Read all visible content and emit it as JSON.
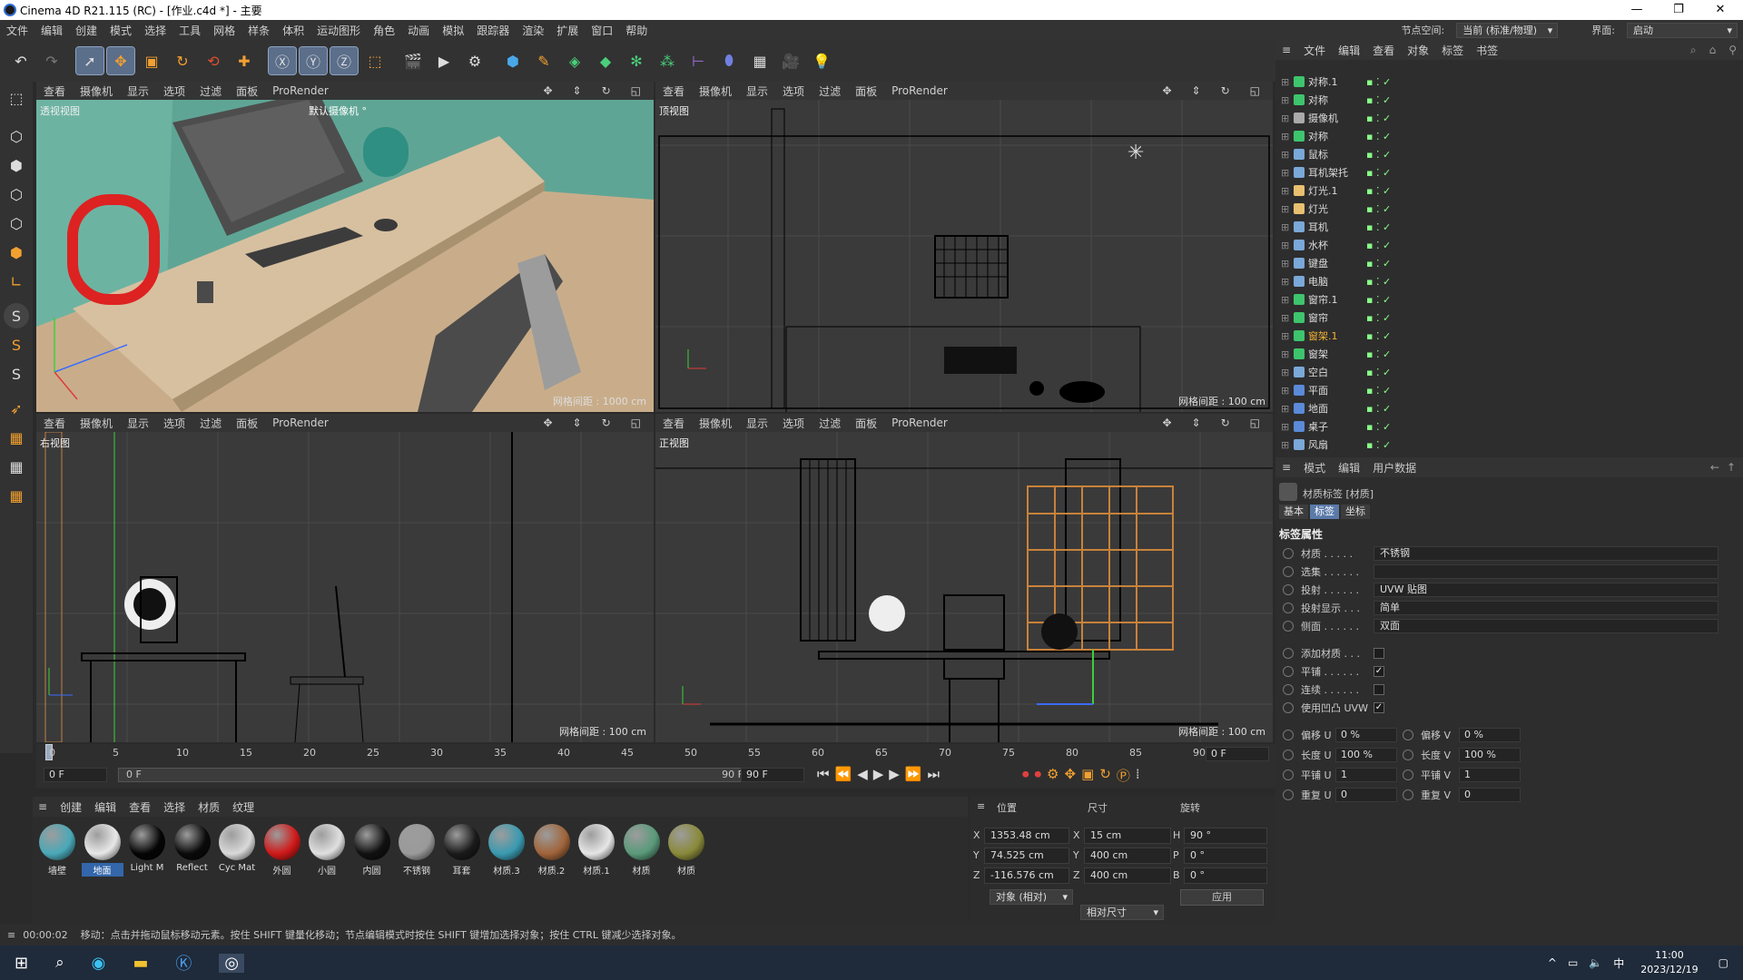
{
  "window": {
    "title": "Cinema 4D R21.115 (RC) - [作业.c4d *] - 主要"
  },
  "menu": [
    "文件",
    "编辑",
    "创建",
    "模式",
    "选择",
    "工具",
    "网格",
    "样条",
    "体积",
    "运动图形",
    "角色",
    "动画",
    "模拟",
    "跟踪器",
    "渲染",
    "扩展",
    "窗口",
    "帮助"
  ],
  "node_space": {
    "label": "节点空间:",
    "value": "当前 (标准/物理)"
  },
  "interface": {
    "label": "界面:",
    "value": "启动"
  },
  "viewport_menu": [
    "查看",
    "摄像机",
    "显示",
    "选项",
    "过滤",
    "面板",
    "ProRender"
  ],
  "viewports": {
    "persp": {
      "label": "透视视图",
      "camera": "默认摄像机 °",
      "grid": "网格间距 : 1000 cm"
    },
    "top": {
      "label": "顶视图",
      "grid": "网格间距 : 100 cm"
    },
    "right": {
      "label": "右视图",
      "grid": "网格间距 : 100 cm"
    },
    "front": {
      "label": "正视图",
      "grid": "网格间距 : 100 cm"
    }
  },
  "timeline": {
    "ticks": [
      "0",
      "5",
      "10",
      "15",
      "20",
      "25",
      "30",
      "35",
      "40",
      "45",
      "50",
      "55",
      "60",
      "65",
      "70",
      "75",
      "80",
      "85",
      "90"
    ],
    "end_field": "0 F"
  },
  "transport": {
    "start": "0 F",
    "current": "0 F",
    "end1": "90 F",
    "end2": "90 F"
  },
  "material_menu": [
    "创建",
    "编辑",
    "查看",
    "选择",
    "材质",
    "纹理"
  ],
  "materials": [
    {
      "name": "墙壁",
      "color": "#4aa8b8"
    },
    {
      "name": "地面",
      "color": "#e8e8e8",
      "selected": true
    },
    {
      "name": "Light M",
      "color": "#050505"
    },
    {
      "name": "Reflect",
      "color": "#0a0a0a"
    },
    {
      "name": "Cyc Mat",
      "color": "#d9d9d9"
    },
    {
      "name": "外圆",
      "color": "#d01818"
    },
    {
      "name": "小圆",
      "color": "#e0e0e0"
    },
    {
      "name": "内圆",
      "color": "#111111"
    },
    {
      "name": "不锈钢",
      "color": "#9a9a9a"
    },
    {
      "name": "耳套",
      "color": "#1a1a1a"
    },
    {
      "name": "材质.3",
      "color": "#3a9ab0"
    },
    {
      "name": "材质.2",
      "color": "#a0643a"
    },
    {
      "name": "材质.1",
      "color": "#e6e6e6"
    },
    {
      "name": "材质",
      "color": "#5a9a7a"
    },
    {
      "name": "材质",
      "color": "#8a8a3a"
    }
  ],
  "coords": {
    "headers": [
      "位置",
      "尺寸",
      "旋转"
    ],
    "rows": [
      {
        "axis": "X",
        "pos": "1353.48 cm",
        "saxis": "X",
        "size": "15 cm",
        "raxis": "H",
        "rot": "90 °"
      },
      {
        "axis": "Y",
        "pos": "74.525 cm",
        "saxis": "Y",
        "size": "400 cm",
        "raxis": "P",
        "rot": "0 °"
      },
      {
        "axis": "Z",
        "pos": "-116.576 cm",
        "saxis": "Z",
        "size": "400 cm",
        "raxis": "B",
        "rot": "0 °"
      }
    ],
    "mode1": "对象 (相对)",
    "mode2": "相对尺寸",
    "apply": "应用"
  },
  "object_menu": [
    "文件",
    "编辑",
    "查看",
    "对象",
    "标签",
    "书签"
  ],
  "objects": [
    {
      "name": "对称.1",
      "color": "#3ec46d"
    },
    {
      "name": "对称",
      "color": "#3ec46d"
    },
    {
      "name": "摄像机",
      "color": "#aaaaaa"
    },
    {
      "name": "对称",
      "color": "#3ec46d"
    },
    {
      "name": "鼠标",
      "color": "#7aa8d8"
    },
    {
      "name": "耳机架托",
      "color": "#7aa8d8"
    },
    {
      "name": "灯光.1",
      "color": "#e8c070"
    },
    {
      "name": "灯光",
      "color": "#e8c070"
    },
    {
      "name": "耳机",
      "color": "#7aa8d8"
    },
    {
      "name": "水杯",
      "color": "#7aa8d8"
    },
    {
      "name": "键盘",
      "color": "#7aa8d8"
    },
    {
      "name": "电脑",
      "color": "#7aa8d8"
    },
    {
      "name": "窗帘.1",
      "color": "#3ec46d"
    },
    {
      "name": "窗帘",
      "color": "#3ec46d"
    },
    {
      "name": "窗架.1",
      "color": "#3ec46d",
      "highlight": true
    },
    {
      "name": "窗架",
      "color": "#3ec46d"
    },
    {
      "name": "空白",
      "color": "#7aa8d8"
    },
    {
      "name": "平面",
      "color": "#5a8ad8"
    },
    {
      "name": "地面",
      "color": "#5a8ad8"
    },
    {
      "name": "桌子",
      "color": "#5a8ad8"
    },
    {
      "name": "风扇",
      "color": "#7aa8d8"
    }
  ],
  "attr_menu": [
    "模式",
    "编辑",
    "用户数据"
  ],
  "attr": {
    "title": "材质标签 [材质]",
    "tabs": [
      "基本",
      "标签",
      "坐标"
    ],
    "section": "标签属性",
    "material": {
      "k": "材质 . . . . .",
      "v": "不锈钢"
    },
    "selection": {
      "k": "选集 . . . . . .",
      "v": ""
    },
    "projection": {
      "k": "投射 . . . . . .",
      "v": "UVW 贴图"
    },
    "proj_display": {
      "k": "投射显示 . . .",
      "v": "简单"
    },
    "side": {
      "k": "侧面 . . . . . .",
      "v": "双面"
    },
    "add_mat": "添加材质 . . .",
    "tile": "平铺 . . . . . .",
    "continuous": "连续 . . . . . .",
    "use_bump_uvw": "使用凹凸 UVW",
    "offset_u": {
      "k": "偏移 U",
      "v": "0 %"
    },
    "offset_v": {
      "k": "偏移 V",
      "v": "0 %"
    },
    "len_u": {
      "k": "长度 U",
      "v": "100 %"
    },
    "len_v": {
      "k": "长度 V",
      "v": "100 %"
    },
    "tile_u": {
      "k": "平铺 U",
      "v": "1"
    },
    "tile_v": {
      "k": "平铺 V",
      "v": "1"
    },
    "rep_u": {
      "k": "重复 U",
      "v": "0"
    },
    "rep_v": {
      "k": "重复 V",
      "v": "0"
    }
  },
  "status": {
    "time": "00:00:02",
    "message": "移动：点击并拖动鼠标移动元素。按住 SHIFT 键量化移动；节点编辑模式时按住 SHIFT 键增加选择对象；按住 CTRL 键减少选择对象。"
  },
  "taskbar": {
    "time": "11:00",
    "date": "2023/12/19",
    "ime": "中"
  }
}
